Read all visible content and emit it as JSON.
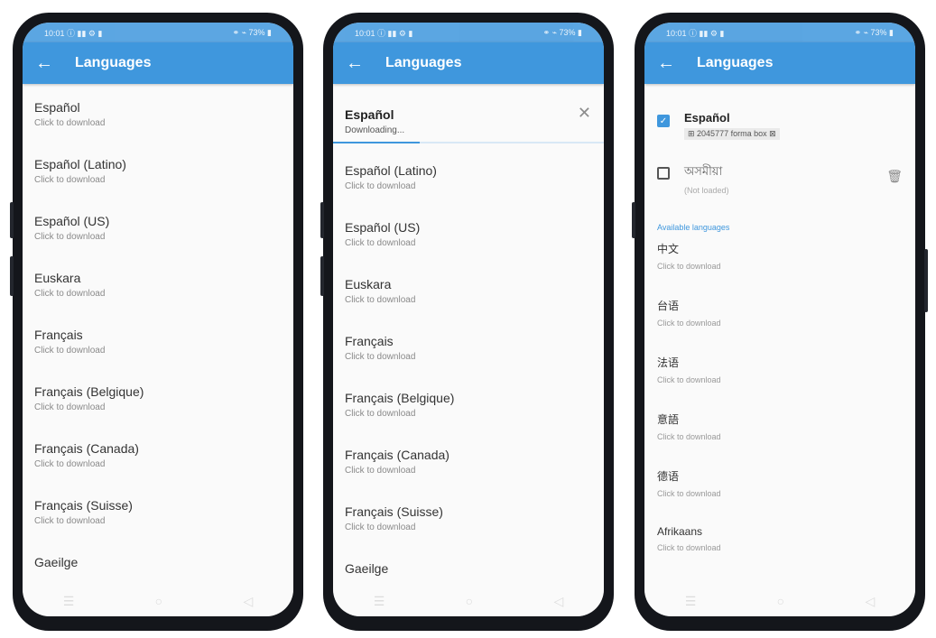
{
  "common": {
    "title": "Languages",
    "status_left": "10:01 ⓘ ▮▮ ⚙ ▮",
    "status_right": "⚭ ⌁ 73% ▮"
  },
  "phone1": {
    "items": [
      {
        "name": "Español",
        "sub": "Click to download"
      },
      {
        "name": "Español (Latino)",
        "sub": "Click to download"
      },
      {
        "name": "Español (US)",
        "sub": "Click to download"
      },
      {
        "name": "Euskara",
        "sub": "Click to download"
      },
      {
        "name": "Français",
        "sub": "Click to download"
      },
      {
        "name": "Français (Belgique)",
        "sub": "Click to download"
      },
      {
        "name": "Français (Canada)",
        "sub": "Click to download"
      },
      {
        "name": "Français (Suisse)",
        "sub": "Click to download"
      },
      {
        "name": "Gaeilge"
      }
    ]
  },
  "phone2": {
    "downloading": {
      "name": "Español",
      "sub": "Downloading...",
      "progress": 0.32
    },
    "items": [
      {
        "name": "Español (Latino)",
        "sub": "Click to download"
      },
      {
        "name": "Español (US)",
        "sub": "Click to download"
      },
      {
        "name": "Euskara",
        "sub": "Click to download"
      },
      {
        "name": "Français",
        "sub": "Click to download"
      },
      {
        "name": "Français (Belgique)",
        "sub": "Click to download"
      },
      {
        "name": "Français (Canada)",
        "sub": "Click to download"
      },
      {
        "name": "Français (Suisse)",
        "sub": "Click to download"
      },
      {
        "name": "Gaeilge"
      }
    ]
  },
  "phone3": {
    "downloaded": [
      {
        "name": "Español",
        "sub": "⊞ 2045777 forma box ⊠",
        "checked": true
      },
      {
        "name": "অসমীয়া",
        "sub": "(Not loaded)",
        "checked": false
      }
    ],
    "section_header": "Available languages",
    "available": [
      {
        "name": "中文",
        "sub": "Click to download"
      },
      {
        "name": "台语",
        "sub": "Click to download"
      },
      {
        "name": "法语",
        "sub": "Click to download"
      },
      {
        "name": "意語",
        "sub": "Click to download"
      },
      {
        "name": "德语",
        "sub": "Click to download"
      },
      {
        "name": "Afrikaans",
        "sub": "Click to download"
      }
    ]
  },
  "icons": {
    "back": "←",
    "close": "✕",
    "check": "✓",
    "trash": "🗑",
    "nav_menu": "☰",
    "nav_home": "○",
    "nav_back": "◁"
  },
  "colors": {
    "accent": "#3f97dd",
    "frame": "#14161b"
  }
}
